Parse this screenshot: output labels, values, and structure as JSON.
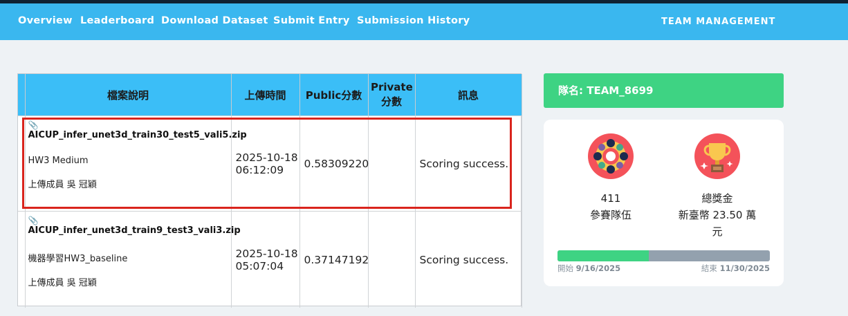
{
  "nav": {
    "items": [
      "Overview",
      "Leaderboard",
      "Download Dataset",
      "Submit Entry",
      "Submission History"
    ],
    "right": "TEAM MANAGEMENT"
  },
  "table": {
    "headers": [
      "檔案說明",
      "上傳時間",
      "Public分數",
      "Private 分數",
      "訊息"
    ],
    "rows": [
      {
        "file": "AICUP_infer_unet3d_train30_test5_vali5.zip",
        "desc": "HW3 Medium",
        "uploader": "上傳成員 吳 冠穎",
        "date": "2025-10-18",
        "time": "06:12:09",
        "public": "0.58309220",
        "private": "",
        "message": "Scoring success."
      },
      {
        "file": "AICUP_infer_unet3d_train9_test3_vali3.zip",
        "desc": "機器學習HW3_baseline",
        "uploader": "上傳成員 吳 冠穎",
        "date": "2025-10-18",
        "time": "05:07:04",
        "public": "0.37147192",
        "private": "",
        "message": "Scoring success."
      }
    ]
  },
  "team": {
    "label": "隊名: TEAM_8699"
  },
  "stats": {
    "teams_count": "411",
    "teams_label": "參賽隊伍",
    "prize_title": "總獎金",
    "prize_line1": "新臺幣 23.50 萬",
    "prize_line2": "元",
    "progress_fraction": 0.43,
    "start_label": "開始",
    "start_date": "9/16/2025",
    "end_label": "結束",
    "end_date": "11/30/2025"
  },
  "colors": {
    "nav": "#3ab7ef",
    "header": "#3bbef7",
    "team_badge": "#3ed383",
    "highlight": "#d9241d",
    "icon_bg": "#f4525a"
  },
  "icons": [
    "paperclip-icon",
    "teams-icon",
    "trophy-icon"
  ]
}
